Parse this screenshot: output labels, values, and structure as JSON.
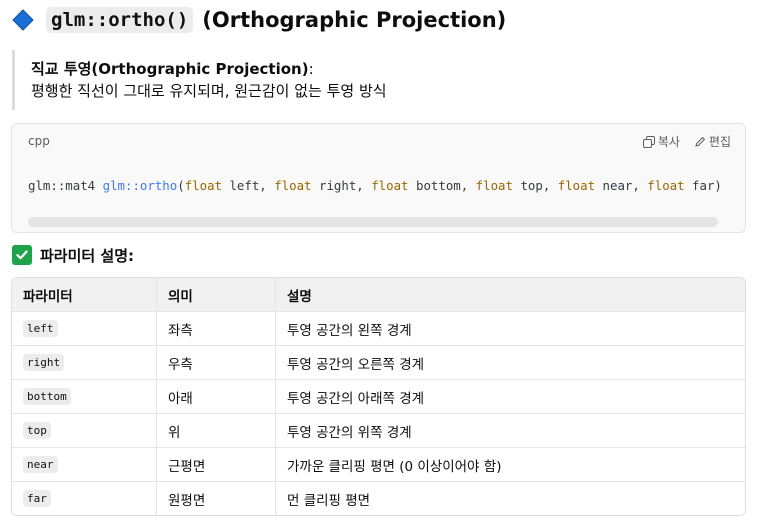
{
  "heading": {
    "code": "glm::ortho()",
    "title": "(Orthographic Projection)",
    "color": "#1a6fd4"
  },
  "quote": {
    "line1_bold": "직교 투영(Orthographic Projection)",
    "line1_rest": ":",
    "line2": "평행한 직선이 그대로 유지되며, 원근감이 없는 투영 방식"
  },
  "codeblock": {
    "lang": "cpp",
    "copy_label": "복사",
    "edit_label": "편집",
    "tokens": [
      {
        "t": "glm::mat4 ",
        "c": "plain"
      },
      {
        "t": "glm::ortho",
        "c": "fn"
      },
      {
        "t": "(",
        "c": "plain"
      },
      {
        "t": "float",
        "c": "kw"
      },
      {
        "t": " left, ",
        "c": "plain"
      },
      {
        "t": "float",
        "c": "kw"
      },
      {
        "t": " right, ",
        "c": "plain"
      },
      {
        "t": "float",
        "c": "kw"
      },
      {
        "t": " bottom, ",
        "c": "plain"
      },
      {
        "t": "float",
        "c": "kw"
      },
      {
        "t": " top, ",
        "c": "plain"
      },
      {
        "t": "float",
        "c": "kw"
      },
      {
        "t": " near, ",
        "c": "plain"
      },
      {
        "t": "float",
        "c": "kw"
      },
      {
        "t": " far)",
        "c": "plain"
      }
    ]
  },
  "params_heading": "파라미터 설명:",
  "table": {
    "headers": [
      "파라미터",
      "의미",
      "설명"
    ],
    "rows": [
      {
        "param": "left",
        "meaning": "좌측",
        "desc": "투영 공간의 왼쪽 경계"
      },
      {
        "param": "right",
        "meaning": "우측",
        "desc": "투영 공간의 오른쪽 경계"
      },
      {
        "param": "bottom",
        "meaning": "아래",
        "desc": "투영 공간의 아래쪽 경계"
      },
      {
        "param": "top",
        "meaning": "위",
        "desc": "투영 공간의 위쪽 경계"
      },
      {
        "param": "near",
        "meaning": "근평면",
        "desc": "가까운 클리핑 평면 (0 이상이어야 함)"
      },
      {
        "param": "far",
        "meaning": "원평면",
        "desc": "먼 클리핑 평면"
      }
    ]
  }
}
